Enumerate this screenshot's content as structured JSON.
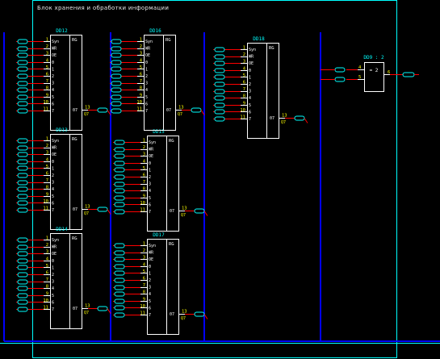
{
  "frame": {
    "title": "Блок хранения и обработки информации"
  },
  "colors": {
    "background": "#000000",
    "frame": "#00ffff",
    "bus": "#0000ff",
    "wire": "#ff0000",
    "chip": "#ffffff",
    "chip_label": "#00ffff",
    "pin_number": "#ffff00",
    "connector": "#00ffff"
  },
  "ram_pins": [
    "Syn",
    "WR",
    "OE",
    "0",
    "1",
    "2",
    "3",
    "4",
    "5",
    "6",
    "7"
  ],
  "ram_pin_numbers": [
    "1",
    "2",
    "3",
    "4",
    "5",
    "6",
    "7",
    "8",
    "9",
    "10",
    "11"
  ],
  "chips": [
    {
      "id": "DD12",
      "type": "RG",
      "out_pin": "07",
      "out_number": "13",
      "out_tag": "Q7"
    },
    {
      "id": "DD13",
      "type": "RG",
      "out_pin": "07",
      "out_number": "13",
      "out_tag": "Q7"
    },
    {
      "id": "DD14",
      "type": "RG",
      "out_pin": "07",
      "out_number": "13",
      "out_tag": "Q7"
    },
    {
      "id": "DD15",
      "type": "RG",
      "out_pin": "07",
      "out_number": "13",
      "out_tag": "Q7"
    },
    {
      "id": "DD16",
      "type": "RG",
      "out_pin": "07",
      "out_number": "13",
      "out_tag": "Q7"
    },
    {
      "id": "DD17",
      "type": "RG",
      "out_pin": "07",
      "out_number": "13",
      "out_tag": "Q7"
    },
    {
      "id": "DD18",
      "type": "RG",
      "out_pin": "07",
      "out_number": "13",
      "out_tag": "Q7"
    }
  ],
  "logic_gate": {
    "id": "DD9 : 2",
    "symbol": "= 2",
    "input_pins": [
      "4",
      "5"
    ],
    "output_pin": "6"
  }
}
